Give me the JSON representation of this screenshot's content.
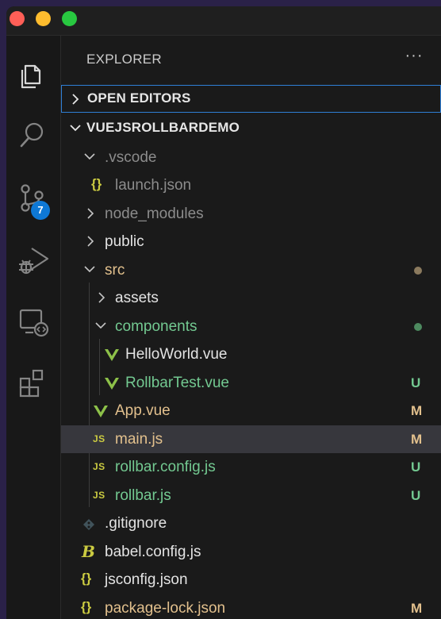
{
  "window": {
    "traffic_lights": [
      "close",
      "minimize",
      "zoom"
    ]
  },
  "activity_bar": {
    "items": [
      {
        "name": "explorer-icon"
      },
      {
        "name": "search-icon"
      },
      {
        "name": "source-control-icon",
        "badge": "7"
      },
      {
        "name": "run-debug-icon"
      },
      {
        "name": "remote-explorer-icon"
      },
      {
        "name": "extensions-icon"
      }
    ]
  },
  "sidebar": {
    "title": "EXPLORER",
    "more": "···",
    "open_editors": "OPEN EDITORS",
    "project": "VUEJSROLLBARDEMO",
    "tree": [
      {
        "label": ".vscode",
        "type": "folder",
        "expanded": true
      },
      {
        "label": "launch.json",
        "type": "json",
        "icon": "{}"
      },
      {
        "label": "node_modules",
        "type": "folder",
        "expanded": false
      },
      {
        "label": "public",
        "type": "folder",
        "expanded": false
      },
      {
        "label": "src",
        "type": "folder",
        "expanded": true
      },
      {
        "label": "assets",
        "type": "folder",
        "expanded": false
      },
      {
        "label": "components",
        "type": "folder",
        "expanded": true
      },
      {
        "label": "HelloWorld.vue",
        "type": "vue"
      },
      {
        "label": "RollbarTest.vue",
        "type": "vue",
        "status": "U"
      },
      {
        "label": "App.vue",
        "type": "vue",
        "status": "M"
      },
      {
        "label": "main.js",
        "type": "js",
        "icon": "JS",
        "status": "M"
      },
      {
        "label": "rollbar.config.js",
        "type": "js",
        "icon": "JS",
        "status": "U"
      },
      {
        "label": "rollbar.js",
        "type": "js",
        "icon": "JS",
        "status": "U"
      },
      {
        "label": ".gitignore",
        "type": "git"
      },
      {
        "label": "babel.config.js",
        "type": "babel",
        "icon": "B"
      },
      {
        "label": "jsconfig.json",
        "type": "json",
        "icon": "{}"
      },
      {
        "label": "package-lock.json",
        "type": "json",
        "icon": "{}",
        "status": "M"
      }
    ]
  },
  "colors": {
    "untracked": "#73c991",
    "modified": "#e2c08d",
    "ignored": "#8c8c8c",
    "selection": "#37373d",
    "focus_border": "#2f7fd6",
    "badge": "#0e78d5"
  }
}
